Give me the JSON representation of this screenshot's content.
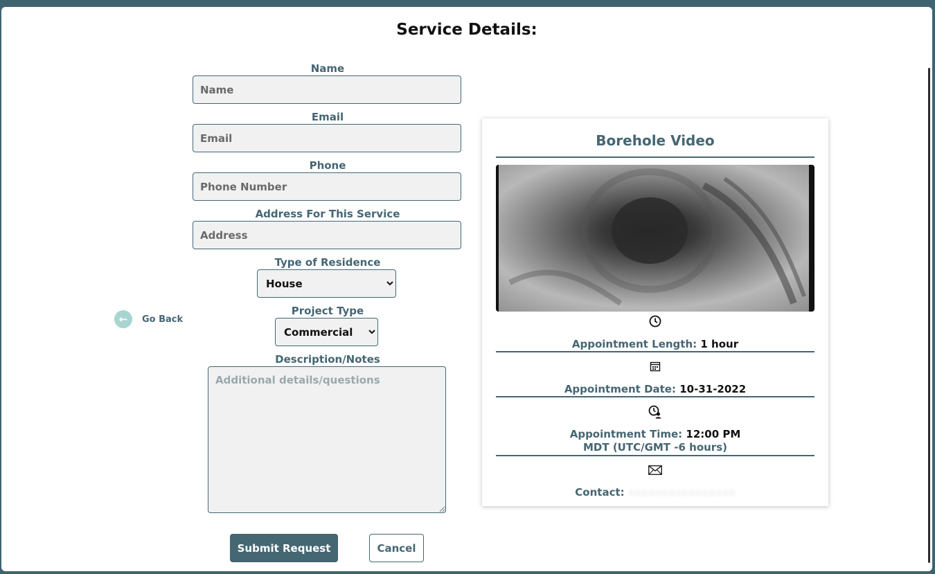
{
  "page": {
    "title": "Service Details:"
  },
  "form": {
    "name": {
      "label": "Name",
      "placeholder": "Name"
    },
    "email": {
      "label": "Email",
      "placeholder": "Email"
    },
    "phone": {
      "label": "Phone",
      "placeholder": "Phone Number"
    },
    "address": {
      "label": "Address For This Service",
      "placeholder": "Address"
    },
    "residence": {
      "label": "Type of Residence",
      "selected": "House"
    },
    "project": {
      "label": "Project Type",
      "selected": "Commercial"
    },
    "notes": {
      "label": "Description/Notes",
      "placeholder": "Additional details/questions"
    }
  },
  "nav": {
    "go_back": "Go Back"
  },
  "actions": {
    "submit": "Submit Request",
    "cancel": "Cancel"
  },
  "service_card": {
    "title": "Borehole Video",
    "length_label": "Appointment Length:",
    "length_value": "1 hour",
    "date_label": "Appointment Date:",
    "date_value": "10-31-2022",
    "time_label": "Appointment Time:",
    "time_value": "12:00 PM",
    "timezone": "MDT (UTC/GMT -6 hours)",
    "contact_label": "Contact:",
    "icons": [
      "clock-icon",
      "calendar-icon",
      "clock-user-icon",
      "envelope-icon"
    ]
  },
  "colors": {
    "accent": "#456673",
    "go_back_circle": "#a9d5d1",
    "field_bg": "#f1f1f1"
  }
}
